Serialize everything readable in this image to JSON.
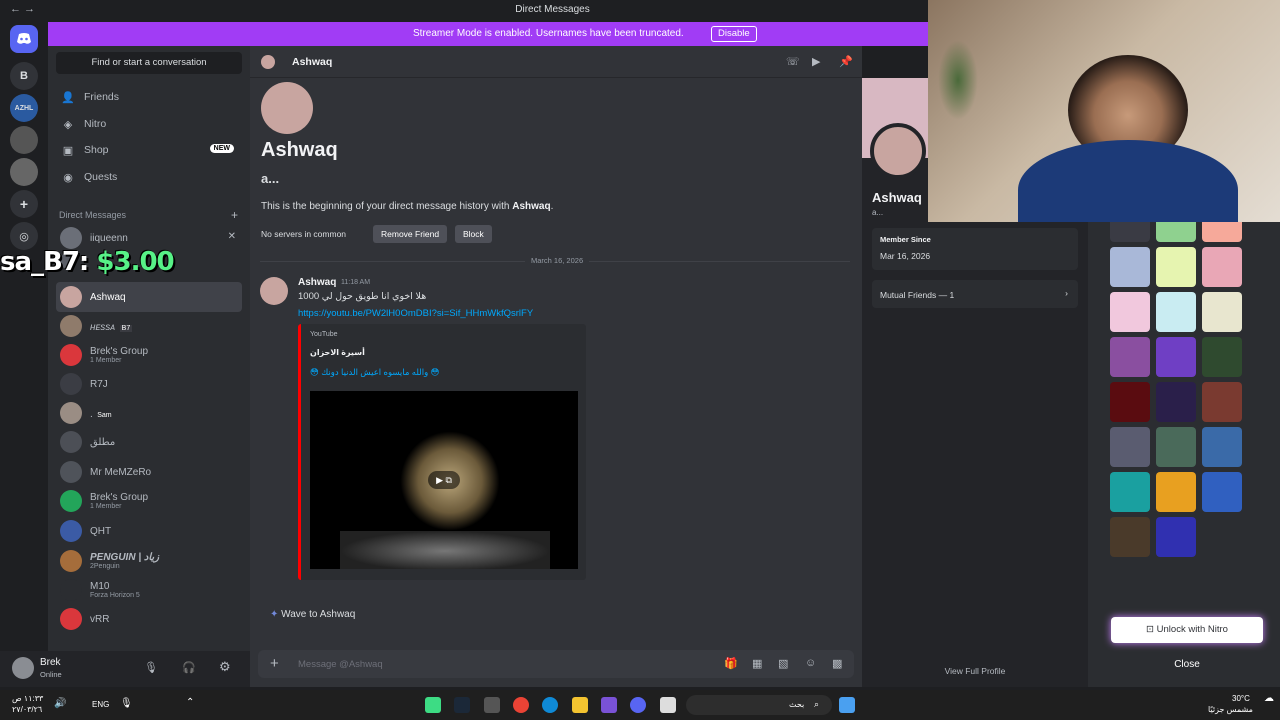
{
  "window": {
    "title": "Direct Messages",
    "nav": "← →"
  },
  "banner": {
    "text": "Streamer Mode is enabled. Usernames have been truncated.",
    "disable_label": "Disable"
  },
  "servers": [
    {
      "label": ""
    },
    {
      "label": "B"
    },
    {
      "label": "AZHL"
    }
  ],
  "sidebar": {
    "search": "Find or start a conversation",
    "nav": [
      {
        "label": "Friends",
        "icon": "friends-icon"
      },
      {
        "label": "Nitro",
        "icon": "nitro-icon"
      },
      {
        "label": "Shop",
        "icon": "shop-icon",
        "badge": "NEW"
      },
      {
        "label": "Quests",
        "icon": "quests-icon"
      }
    ],
    "dm_header": "Direct Messages",
    "dms": [
      {
        "name": "iiqueenn",
        "sub": "",
        "color": "#6b6f78"
      },
      {
        "name": "",
        "sub": "",
        "color": "#5b5e66"
      },
      {
        "name": "Ashwaq",
        "sub": "",
        "color": "#c8a5a0"
      },
      {
        "name": "ʜᴇssᴀ",
        "tag": "B7",
        "sub": "",
        "color": "#8f7b6b"
      },
      {
        "name": "Brek's Group",
        "sub": "1 Member",
        "color": "#da373c"
      },
      {
        "name": "R7J",
        "sub": "",
        "color": "#3b3d44"
      },
      {
        "name": ".",
        "tag": "Sam",
        "sub": "",
        "color": "#9a8d84"
      },
      {
        "name": "مطلق",
        "sub": "",
        "color": "#4c4f56"
      },
      {
        "name": "Mr MeMZeRo",
        "sub": "",
        "color": "#4f535a"
      },
      {
        "name": "Brek's Group",
        "sub": "1 Member",
        "color": "#23a55a"
      },
      {
        "name": "QHT",
        "sub": "",
        "color": "#3b5ba5"
      },
      {
        "name": "PENGUIN | زياد",
        "sub": "2Penguin",
        "color": "#a56d3b"
      },
      {
        "name": "M10",
        "sub": "Forza Horizon 5",
        "color": "#2b2d31"
      },
      {
        "name": "vRR",
        "sub": "",
        "color": "#da373c"
      }
    ]
  },
  "overlay": {
    "prefix": "sa_B7: ",
    "amount": "$3.00"
  },
  "user": {
    "name": "Brek",
    "status": "Online"
  },
  "chat": {
    "recipient": "Ashwaq",
    "big_name": "Ashwaq",
    "username": "a...",
    "beginning_prefix": "This is the beginning of your direct message history with ",
    "beginning_name": "Ashwaq",
    "beginning_suffix": ".",
    "no_servers": "No servers in common",
    "remove_friend": "Remove Friend",
    "block": "Block",
    "date": "March 16, 2026",
    "message": {
      "author": "Ashwaq",
      "time": "11:18 AM",
      "text": "هلا اخوي انا طويق حول لي 1000",
      "link": "https://youtu.be/PW2lH0OmDBI?si=Sif_HHmWkfQsrlFY"
    },
    "embed": {
      "provider": "YouTube",
      "channel": "أسيرة الاحزان",
      "video_title": "😳 والله مايسوه اعيش الدنيا دونك 😳"
    },
    "wave": "Wave to Ashwaq",
    "input_placeholder": "Message @Ashwaq"
  },
  "profile": {
    "name": "Ashwaq",
    "sub": "a...",
    "member_since_label": "Member Since",
    "member_since": "Mar 16, 2026",
    "mutual_friends": "Mutual Friends — 1",
    "view_full": "View Full Profile"
  },
  "themes": {
    "swatches": [
      "#3a3b44",
      "#8fd18f",
      "#f6a99a",
      "#a9b8d8",
      "#e6f4b0",
      "#e9a7b6",
      "#f1c8dd",
      "#c9ecf2",
      "#e8e6cf",
      "#8a4fa0",
      "#6f3fc4",
      "#2f4a2f",
      "#5a0c10",
      "#2a1f4a",
      "#7a3a30",
      "#5a5c70",
      "#4a6a5a",
      "#3a6aa8",
      "#1aa0a0",
      "#e8a020",
      "#3060c0",
      "#4a3a2a",
      "#3030b0"
    ],
    "unlock": "Unlock with Nitro",
    "close": "Close"
  },
  "taskbar": {
    "time": "١١:٣٣ ص",
    "date": "٢٧/٠٣/٢٦",
    "lang": "ENG",
    "search": "بحث",
    "weather_temp": "30°C",
    "weather_desc": "مشمس جزئيًا"
  }
}
